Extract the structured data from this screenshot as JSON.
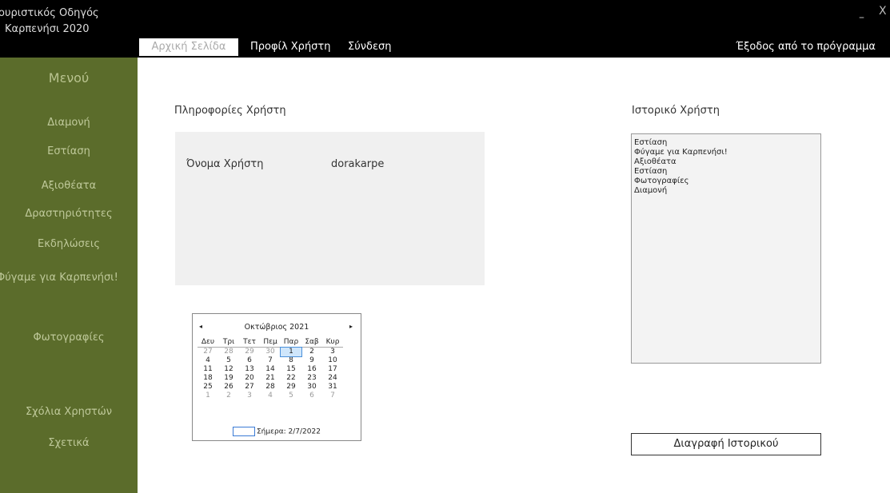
{
  "app": {
    "title_line1": "ουριστικός Οδηγός",
    "title_line2": "Καρπενήσι 2020",
    "minimize_glyph": "–",
    "close_glyph": "X"
  },
  "tabs": [
    {
      "label": "Αρχική Σελίδα"
    },
    {
      "label": "Προφίλ Χρήστη"
    },
    {
      "label": "Σύνδεση"
    }
  ],
  "exit_label": "Έξοδος από το πρόγραμμα",
  "sidebar": {
    "title": "Μενού",
    "items": [
      {
        "label": "Διαμονή"
      },
      {
        "label": "Εστίαση"
      },
      {
        "label": "Αξιοθέατα"
      },
      {
        "label": "Δραστηριότητες"
      },
      {
        "label": "Εκδηλώσεις"
      },
      {
        "label": "Φύγαμε για Καρπενήσι!"
      },
      {
        "label": "Φωτογραφίες"
      },
      {
        "label": "Σχόλια Χρηστών"
      },
      {
        "label": "Σχετικά"
      }
    ]
  },
  "user_info": {
    "heading": "Πληροφορίες Χρήστη",
    "username_label": "Όνομα Χρήστη",
    "username_value": "dorakarpe"
  },
  "history": {
    "heading": "Ιστορικό Χρήστη",
    "items": [
      "Εστίαση",
      "Φύγαμε για Καρπενήσι!",
      "Αξιοθέατα",
      "Εστίαση",
      "Φωτογραφίες",
      "Διαμονή"
    ],
    "delete_label": "Διαγραφή Ιστορικού"
  },
  "calendar": {
    "month_label": "Οκτώβριος 2021",
    "prev_glyph": "◂",
    "next_glyph": "▸",
    "weekdays": [
      "Δευ",
      "Τρι",
      "Τετ",
      "Πεμ",
      "Παρ",
      "Σαβ",
      "Κυρ"
    ],
    "weeks": [
      [
        "27",
        "28",
        "29",
        "30",
        "1",
        "2",
        "3"
      ],
      [
        "4",
        "5",
        "6",
        "7",
        "8",
        "9",
        "10"
      ],
      [
        "11",
        "12",
        "13",
        "14",
        "15",
        "16",
        "17"
      ],
      [
        "18",
        "19",
        "20",
        "21",
        "22",
        "23",
        "24"
      ],
      [
        "25",
        "26",
        "27",
        "28",
        "29",
        "30",
        "31"
      ],
      [
        "1",
        "2",
        "3",
        "4",
        "5",
        "6",
        "7"
      ]
    ],
    "other_month": [
      [
        0,
        0
      ],
      [
        0,
        1
      ],
      [
        0,
        2
      ],
      [
        0,
        3
      ],
      [
        5,
        0
      ],
      [
        5,
        1
      ],
      [
        5,
        2
      ],
      [
        5,
        3
      ],
      [
        5,
        4
      ],
      [
        5,
        5
      ],
      [
        5,
        6
      ]
    ],
    "selected": [
      0,
      4
    ],
    "today_label": "Σήμερα: 2/7/2022"
  }
}
